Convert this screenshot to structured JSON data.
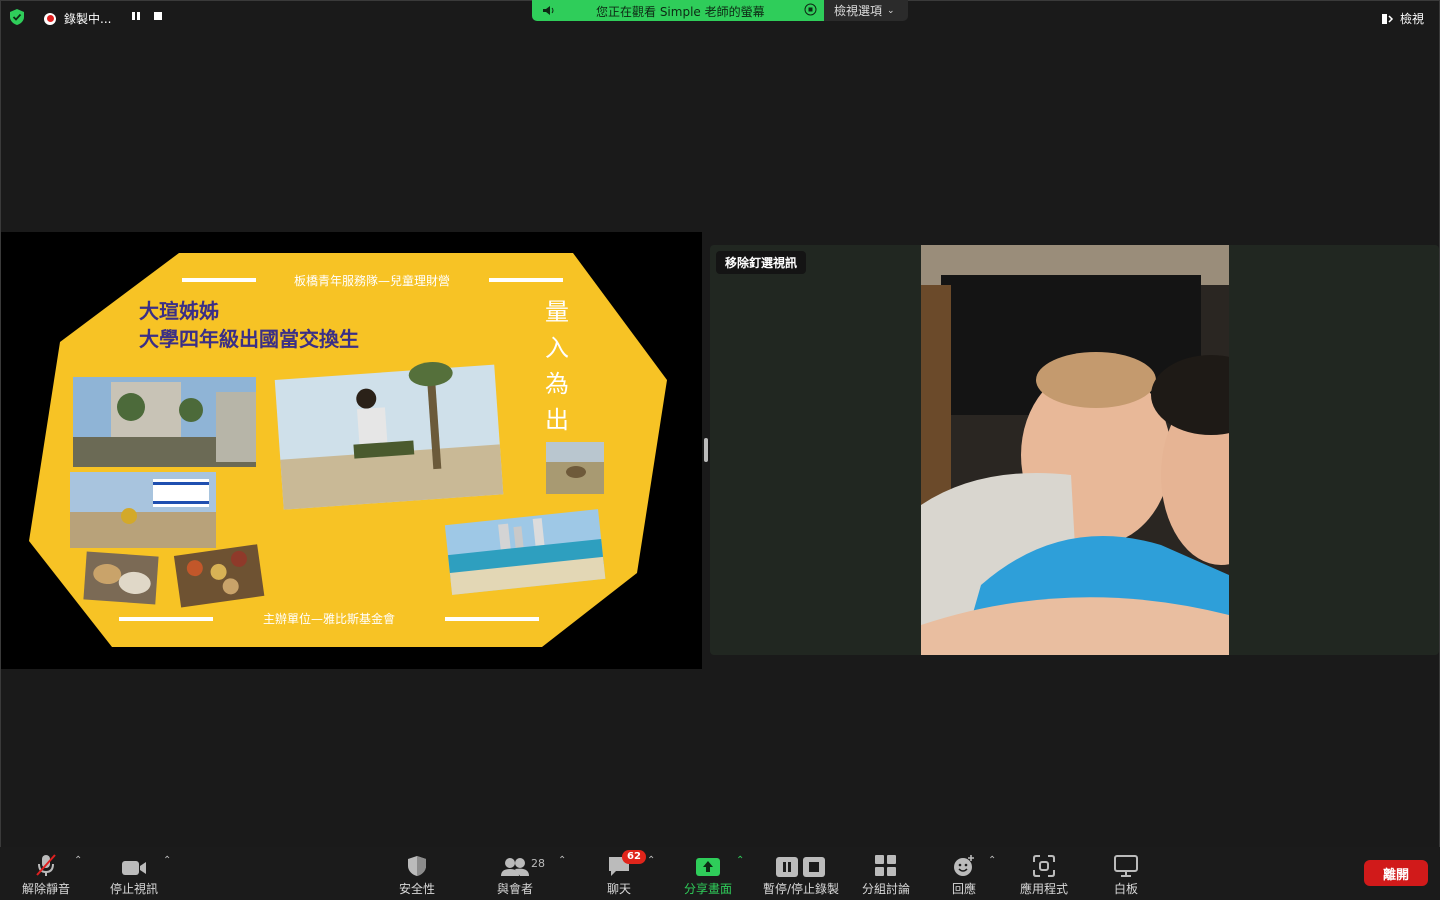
{
  "topbar": {
    "recording_label": "錄製中...",
    "banner_text": "您正在觀看 Simple 老師的螢幕",
    "view_options": "檢視選項",
    "view_label": "檢視"
  },
  "slide": {
    "header": "板橋青年服務隊—兒童理財營",
    "title_line1": "大瑄姊姊",
    "title_line2": "大學四年級出國當交換生",
    "motto": [
      "量",
      "入",
      "為",
      "出"
    ],
    "footer": "主辦單位—雅比斯基金會"
  },
  "video": {
    "unpin_label": "移除釘選視訊"
  },
  "toolbar": {
    "unmute": "解除靜音",
    "stop_video": "停止視訊",
    "security": "安全性",
    "participants": "與會者",
    "participants_count": "28",
    "chat": "聊天",
    "chat_badge": "62",
    "share": "分享畫面",
    "pause_record": "暫停/停止錄製",
    "breakout": "分組討論",
    "reactions": "回應",
    "apps": "應用程式",
    "whiteboard": "白板",
    "leave": "離開"
  },
  "colors": {
    "accent_green": "#2fcd5a",
    "slide_yellow": "#f7c325",
    "leave_red": "#d11a1a"
  }
}
